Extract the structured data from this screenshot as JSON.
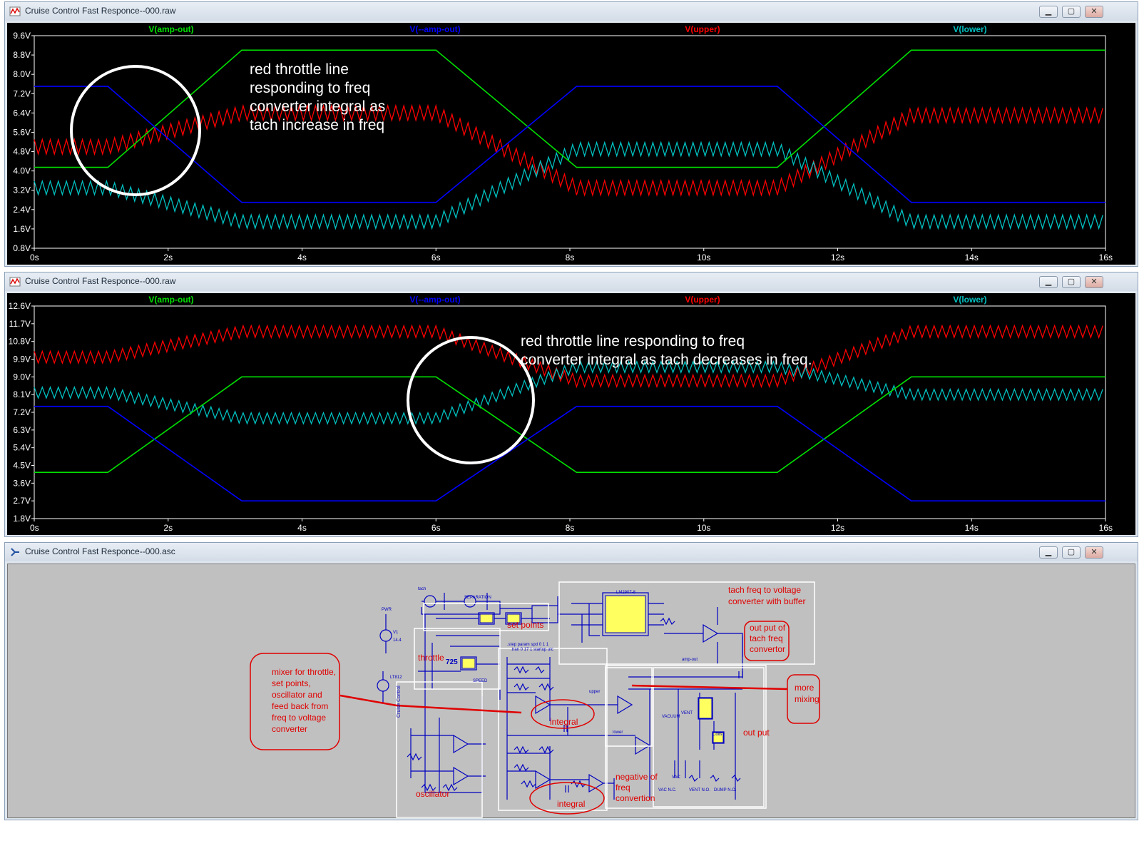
{
  "windows": {
    "plot1": {
      "title": "Cruise Control Fast Responce--000.raw"
    },
    "plot2": {
      "title": "Cruise Control Fast Responce--000.raw"
    },
    "schematic": {
      "title": "Cruise Control Fast Responce--000.asc"
    }
  },
  "window_buttons": {
    "minimize": "▁",
    "maximize": "▢",
    "close": "✕"
  },
  "colors": {
    "amp_out": "#00e000",
    "neg_amp_out": "#0000ff",
    "upper": "#ff0000",
    "lower": "#00c0c0",
    "annotation": "#ffffff",
    "red_note": "#e00000",
    "schematic_blue": "#0000c0"
  },
  "chart_data": [
    {
      "type": "line",
      "x_ticks": [
        "0s",
        "2s",
        "4s",
        "6s",
        "8s",
        "10s",
        "12s",
        "14s",
        "16s"
      ],
      "y_ticks": [
        "9.6V",
        "8.8V",
        "8.0V",
        "7.2V",
        "6.4V",
        "5.6V",
        "4.8V",
        "4.0V",
        "3.2V",
        "2.4V",
        "1.6V",
        "0.8V"
      ],
      "xlim": [
        0,
        16
      ],
      "ylim": [
        0.8,
        9.6
      ],
      "legend": [
        "V(amp-out)",
        "V(--amp-out)",
        "V(upper)",
        "V(lower)"
      ],
      "series": [
        {
          "name": "V(amp-out)",
          "x": [
            0,
            1.1,
            3.1,
            6.0,
            8.1,
            11.1,
            13.1,
            16
          ],
          "y": [
            4.15,
            4.15,
            9.0,
            9.0,
            4.15,
            4.15,
            9.0,
            9.0
          ]
        },
        {
          "name": "V(--amp-out)",
          "x": [
            0,
            1.1,
            3.1,
            6.0,
            8.1,
            11.1,
            13.1,
            16
          ],
          "y": [
            7.5,
            7.5,
            2.7,
            2.7,
            7.5,
            7.5,
            2.7,
            2.7
          ]
        },
        {
          "name": "V(upper)",
          "x": [
            0,
            1.1,
            3.1,
            6.0,
            8.1,
            11.1,
            13.1,
            16
          ],
          "y": [
            5.0,
            5.0,
            6.4,
            6.4,
            3.3,
            3.3,
            6.3,
            6.3
          ],
          "ripple": 0.6
        },
        {
          "name": "V(lower)",
          "x": [
            0,
            1.1,
            3.1,
            6.0,
            8.1,
            11.1,
            13.1,
            16
          ],
          "y": [
            3.3,
            3.3,
            1.9,
            1.9,
            4.9,
            4.9,
            1.9,
            1.9
          ],
          "ripple": 0.55
        }
      ],
      "annotation": [
        "red throttle line",
        "responding to freq",
        "converter integral as",
        "tach increase in freq"
      ]
    },
    {
      "type": "line",
      "x_ticks": [
        "0s",
        "2s",
        "4s",
        "6s",
        "8s",
        "10s",
        "12s",
        "14s",
        "16s"
      ],
      "y_ticks": [
        "12.6V",
        "11.7V",
        "10.8V",
        "9.9V",
        "9.0V",
        "8.1V",
        "7.2V",
        "6.3V",
        "5.4V",
        "4.5V",
        "3.6V",
        "2.7V",
        "1.8V"
      ],
      "xlim": [
        0,
        16
      ],
      "ylim": [
        1.8,
        12.6
      ],
      "legend": [
        "V(amp-out)",
        "V(--amp-out)",
        "V(upper)",
        "V(lower)"
      ],
      "series": [
        {
          "name": "V(amp-out)",
          "x": [
            0,
            1.1,
            3.1,
            6.0,
            8.1,
            11.1,
            13.1,
            16
          ],
          "y": [
            4.15,
            4.15,
            9.0,
            9.0,
            4.15,
            4.15,
            9.0,
            9.0
          ]
        },
        {
          "name": "V(--amp-out)",
          "x": [
            0,
            1.1,
            3.1,
            6.0,
            8.1,
            11.1,
            13.1,
            16
          ],
          "y": [
            7.5,
            7.5,
            2.7,
            2.7,
            7.5,
            7.5,
            2.7,
            2.7
          ]
        },
        {
          "name": "V(upper)",
          "x": [
            0,
            1.1,
            3.1,
            6.0,
            8.1,
            11.1,
            13.1,
            16
          ],
          "y": [
            10.0,
            10.0,
            11.3,
            11.3,
            8.8,
            8.8,
            11.3,
            11.3
          ],
          "ripple": 0.6
        },
        {
          "name": "V(lower)",
          "x": [
            0,
            1.1,
            3.1,
            6.0,
            8.1,
            11.1,
            13.1,
            16
          ],
          "y": [
            8.2,
            8.2,
            6.9,
            6.9,
            9.5,
            9.5,
            8.1,
            8.1
          ],
          "ripple": 0.55
        }
      ],
      "annotation": [
        "red throttle line responding to freq",
        "converter integral as tach decreases in freq."
      ]
    }
  ],
  "schematic": {
    "notes": {
      "tach_freq": [
        "tach freq to voltage",
        "converter with buffer"
      ],
      "output_tach": [
        "out put of",
        "tach freq",
        "convertor"
      ],
      "more_mixing": [
        "more",
        "mixing"
      ],
      "mixer": [
        "mixer for throttle,",
        "set points,",
        "oscillator and",
        "feed back from",
        "freq to voltage",
        "converter"
      ],
      "set_points": "set points",
      "throttle": "throttle",
      "integral1": "integral",
      "integral2": "integral",
      "out_put": "out put",
      "negative": [
        "negative of",
        "freq",
        "convertion"
      ],
      "oscillator": "oscillator"
    },
    "labels": {
      "lm2907": "LM2907-8",
      "pwr": "PWR",
      "v1": "V1",
      "v1_val": "14.4",
      "lt812": "LT812",
      "cruise": "Cruise Control",
      "value_725": "725",
      "speed": "SPEED",
      "vacuum": "VACUUM",
      "vent": "VENT",
      "vac": "VAC",
      "vent_nc": "VENT N.O.",
      "dump_no": "DUMP N.O.",
      "vac_nc": "VAC N.C.",
      "upper": "upper",
      "lower": "lower",
      "step": ".step param spd 0 1 1",
      "tran": ".tran 0 17 1 startup uic",
      "separation": "SEPARATION",
      "amp_out": "amp-out",
      "tach": "tach",
      "coils": "Coils"
    }
  }
}
